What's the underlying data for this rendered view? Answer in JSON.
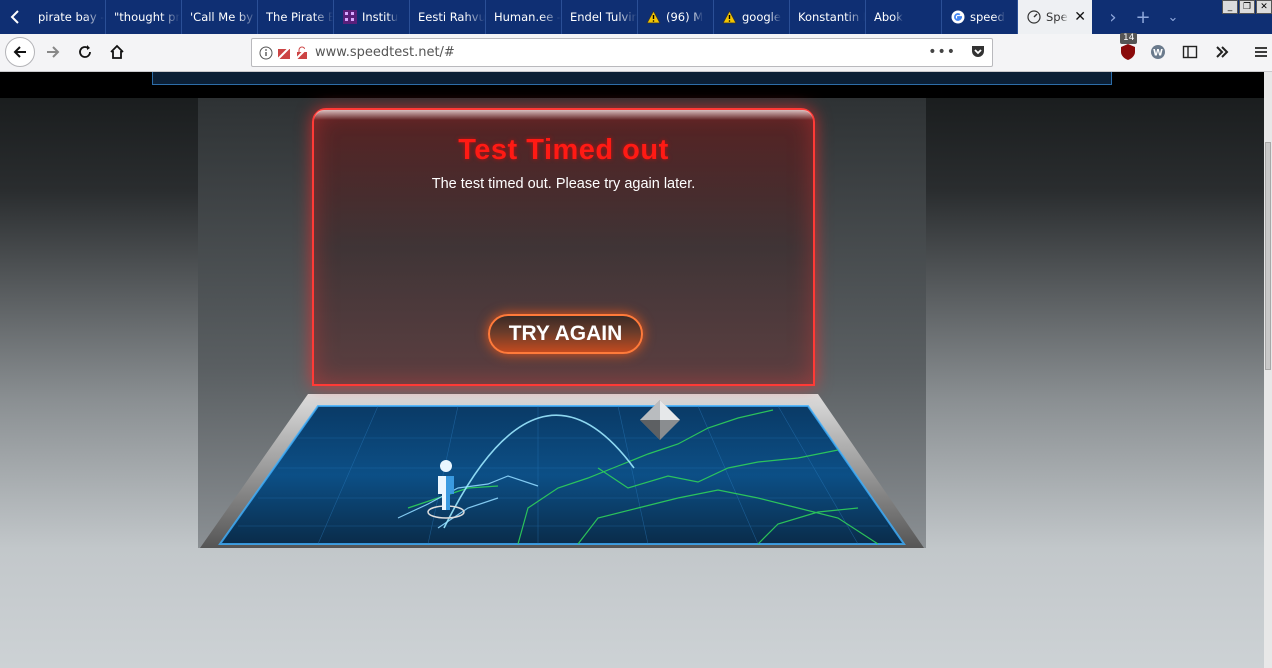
{
  "browser": {
    "tabs": [
      {
        "label": "pirate bay -",
        "icon": "none"
      },
      {
        "label": "\"thought pr",
        "icon": "none"
      },
      {
        "label": "'Call Me by Y",
        "icon": "none"
      },
      {
        "label": "The Pirate B",
        "icon": "none"
      },
      {
        "label": "Institu",
        "icon": "purple-grid-icon"
      },
      {
        "label": "Eesti Rahvu",
        "icon": "none"
      },
      {
        "label": "Human.ee -",
        "icon": "none"
      },
      {
        "label": "Endel Tulvin",
        "icon": "none"
      },
      {
        "label": "(96) M",
        "icon": "warning-icon"
      },
      {
        "label": "google",
        "icon": "warning-icon"
      },
      {
        "label": "Konstantin I",
        "icon": "none"
      },
      {
        "label": "Abok",
        "icon": "none"
      },
      {
        "label": "speed",
        "icon": "google-icon"
      }
    ],
    "active_tab": {
      "label": "Spe",
      "icon": "speedometer-icon"
    },
    "url": "www.speedtest.net/#",
    "extension_badge": "14"
  },
  "speedtest": {
    "error_title": "Test Timed out",
    "error_message": "The test timed out. Please try again later.",
    "button_label": "TRY AGAIN"
  },
  "colors": {
    "tabstrip": "#0f2f73",
    "error_red": "#ff1a14",
    "button_orange": "#c24a1f",
    "map_blue": "#1a8fd6",
    "map_green": "#2fd15a"
  }
}
